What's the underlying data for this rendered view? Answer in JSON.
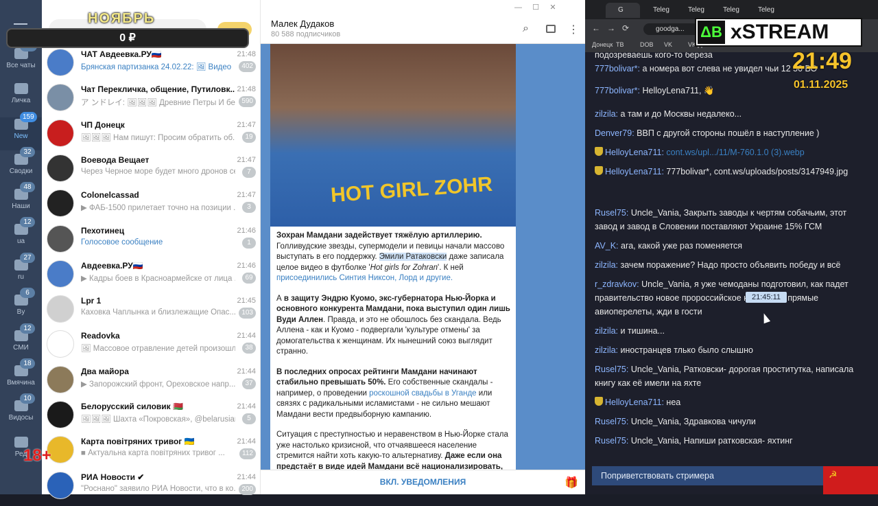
{
  "overlay": {
    "month": "НОЯБРЬ",
    "amount": "0 ₽",
    "age": "18+"
  },
  "folders": [
    {
      "label": "Все чаты",
      "badge": "177"
    },
    {
      "label": "Личка",
      "badge": ""
    },
    {
      "label": "New",
      "badge": "159"
    },
    {
      "label": "Сводки",
      "badge": "32"
    },
    {
      "label": "Наши",
      "badge": "48"
    },
    {
      "label": "ua",
      "badge": "12"
    },
    {
      "label": "ru",
      "badge": "27"
    },
    {
      "label": "By",
      "badge": "6"
    },
    {
      "label": "СМИ",
      "badge": "12"
    },
    {
      "label": "Вмячина",
      "badge": "18"
    },
    {
      "label": "Видосы",
      "badge": "10"
    },
    {
      "label": "Ред",
      "badge": ""
    }
  ],
  "chats": [
    {
      "name": "ЧАТ Авдеевка.РУ🇷🇺",
      "time": "21:48",
      "preview": "Брянская партизанка 24.02.22: 🖼 Видео",
      "count": "402",
      "color": "#4a7cc8"
    },
    {
      "name": "Чат Перекличка, общение, Путиловк...",
      "time": "21:48",
      "preview": "ア ンドレイ: 🖼🖼🖼 Древние Петры И без ...",
      "count": "590",
      "color": "#7a8fa6"
    },
    {
      "name": "ЧП Донецк",
      "time": "21:47",
      "preview": "🖼🖼🖼 Нам пишут: Просим обратить об...",
      "count": "19",
      "color": "#c81e1e"
    },
    {
      "name": "Воевода Вещает",
      "time": "21:47",
      "preview": "Через Черное море будет много дронов се...",
      "count": "7",
      "color": "#333333"
    },
    {
      "name": "Colonelcassad",
      "time": "21:47",
      "preview": "▶ ФАБ-1500 прилетает точно на позиции ...",
      "count": "3",
      "color": "#222222"
    },
    {
      "name": "Пехотинец",
      "time": "21:46",
      "preview": "Голосовое сообщение",
      "count": "1",
      "color": "#555555"
    },
    {
      "name": "Авдеевка.РУ🇷🇺",
      "time": "21:46",
      "preview": "▶ Кадры боев в Красноармейске от лица ...",
      "count": "69",
      "color": "#4a7cc8"
    },
    {
      "name": "Lpr 1",
      "time": "21:45",
      "preview": "Каховка Чаплынка и близлежащие Опас...",
      "count": "103",
      "color": "#d0d0d0"
    },
    {
      "name": "Readovka",
      "time": "21:44",
      "preview": "🖼 Массовое отравление детей произошл...",
      "count": "38",
      "color": "#ffffff"
    },
    {
      "name": "Два майора",
      "time": "21:44",
      "preview": "▶ Запорожский фронт, Ореховское напр...",
      "count": "37",
      "color": "#8c7a5a"
    },
    {
      "name": "Белорусский силовик 🇧🇾",
      "time": "21:44",
      "preview": "🖼🖼🖼 Шахта «Покровская», @belarusian...",
      "count": "5",
      "color": "#1a1a1a"
    },
    {
      "name": "Карта повітряних тривог 🇺🇦",
      "time": "21:44",
      "preview": "■ Актуальна карта повітряних тривог ...",
      "count": "112",
      "color": "#e8b82a"
    },
    {
      "name": "РИА Новости ✔",
      "time": "21:44",
      "preview": "\"Роснано\" заявило РИА Новости, что в ко...",
      "count": "200",
      "color": "#2a62b8"
    }
  ],
  "channel": {
    "title": "Малек Дудаков",
    "subscribers": "80 588 подписчиков",
    "photo_text": "HOT GIRL ZOHR",
    "p1_bold": "Зохран Мамдани задействует тяжёлую артиллерию.",
    "p1_a": " Голливудские звезды, супермодели и певицы начали массово выступать в его поддержку. ",
    "p1_hl": "Эмили Ратаковски",
    "p1_b": " даже записала целое видео в футболке '",
    "p1_i": "Hot girls for Zohran",
    "p1_c": "'. К ней ",
    "p1_link": "присоединились Синтия Никсон, Лорд и другие.",
    "p2_a": "А ",
    "p2_bold": "в защиту Эндрю Куомо, экс-губернатора Нью-Йорка и основного конкурента Мамдани, пока выступил один лишь Вуди Аллен",
    "p2_b": ". Правда, и это не обошлось без скандала. Ведь Аллена - как и Куомо - подвергали 'культуре отмены' за домогательства к женщинам. Их нынешний союз выглядит странно.",
    "p3_bold": "В последних опросах рейтинги Мамдани начинают стабильно превышать 50%.",
    "p3_a": " Его собственные скандалы - например, о проведении ",
    "p3_link": "роскошной свадьбы в Уганде",
    "p3_b": " или связях с радикальными исламистами - не сильно мешают Мамдани вести предвыборную кампанию.",
    "p4_a": "Ситуация с преступностью и неравенством в Нью-Йорке стала уже настолько кризисной, что отчаявшееся население стремится найти хоть какую-то альтернативу. ",
    "p4_bold": "Даже если она предстаёт в виде идей Мамдани всё национализировать, распустить полицию и завозить мигрантов со всего мира",
    "notify": "ВКЛ. УВЕДОМЛЕНИЯ"
  },
  "browser": {
    "tabs": [
      "G",
      "Teleg",
      "Teleg",
      "Teleg",
      "Teleg"
    ],
    "url": "goodga...",
    "bookmarks": [
      "Донецк",
      "ТВ",
      "DOB",
      "VK",
      "VK ДГ"
    ],
    "logo_ab": "ΔB",
    "logo_text": "xSTREAM",
    "clock": "21:49",
    "date": "01.11.2025",
    "tooltip": "21:45:11",
    "greet": "Поприветствовать стримера"
  },
  "messages": [
    {
      "user": "",
      "text": "подозреваешь кого-то береза"
    },
    {
      "user": "777bolivar*:",
      "text": " а номера вот слева не увидел чьи 12 50 ВО"
    },
    {
      "user": "777bolivar*:",
      "text": " HelloyLena711, 👋"
    },
    {
      "user": "zilzila:",
      "text": " а там и до Москвы недалеко..."
    },
    {
      "user": "Denver79:",
      "text": " ВВП с другой стороны пошёл в наступление )"
    },
    {
      "user": "HelloyLena711:",
      "text": " cont.ws/upl.../11/M-760.1.0 (3).webp",
      "badge": true,
      "link": true
    },
    {
      "user": "HelloyLena711:",
      "text": " 777bolivar*, cont.ws/uploads/posts/3147949.jpg",
      "badge": true
    },
    {
      "user": "Rusel75:",
      "text": " Uncle_Vania, Закрыть заводы к чертям собачьим, этот завод и завод в Словении поставляют Украине 15% ГСМ"
    },
    {
      "user": "AV_K:",
      "text": " ага, какой уже раз поменяется"
    },
    {
      "user": "zilzila:",
      "text": " зачем поражение? Надо просто объявить победу и всё"
    },
    {
      "user": "r_zdravkov:",
      "text": " Uncle_Vania, я уже чемоданы подготовил, как падет правительство новое пророссийское н... введёт прямые авиоперелеты, жди в гости"
    },
    {
      "user": "zilzila:",
      "text": " и тишина..."
    },
    {
      "user": "zilzila:",
      "text": " иностранцев тлько было слышно"
    },
    {
      "user": "Rusel75:",
      "text": " Uncle_Vania, Ратковски- дорогая проститутка, написала книгу как её имели на яхте"
    },
    {
      "user": "HelloyLena711:",
      "text": " неа",
      "badge": true
    },
    {
      "user": "Rusel75:",
      "text": " Uncle_Vania, Здравкова чичули"
    },
    {
      "user": "Rusel75:",
      "text": " Uncle_Vania, Напиши ратковская- яхтинг"
    }
  ]
}
